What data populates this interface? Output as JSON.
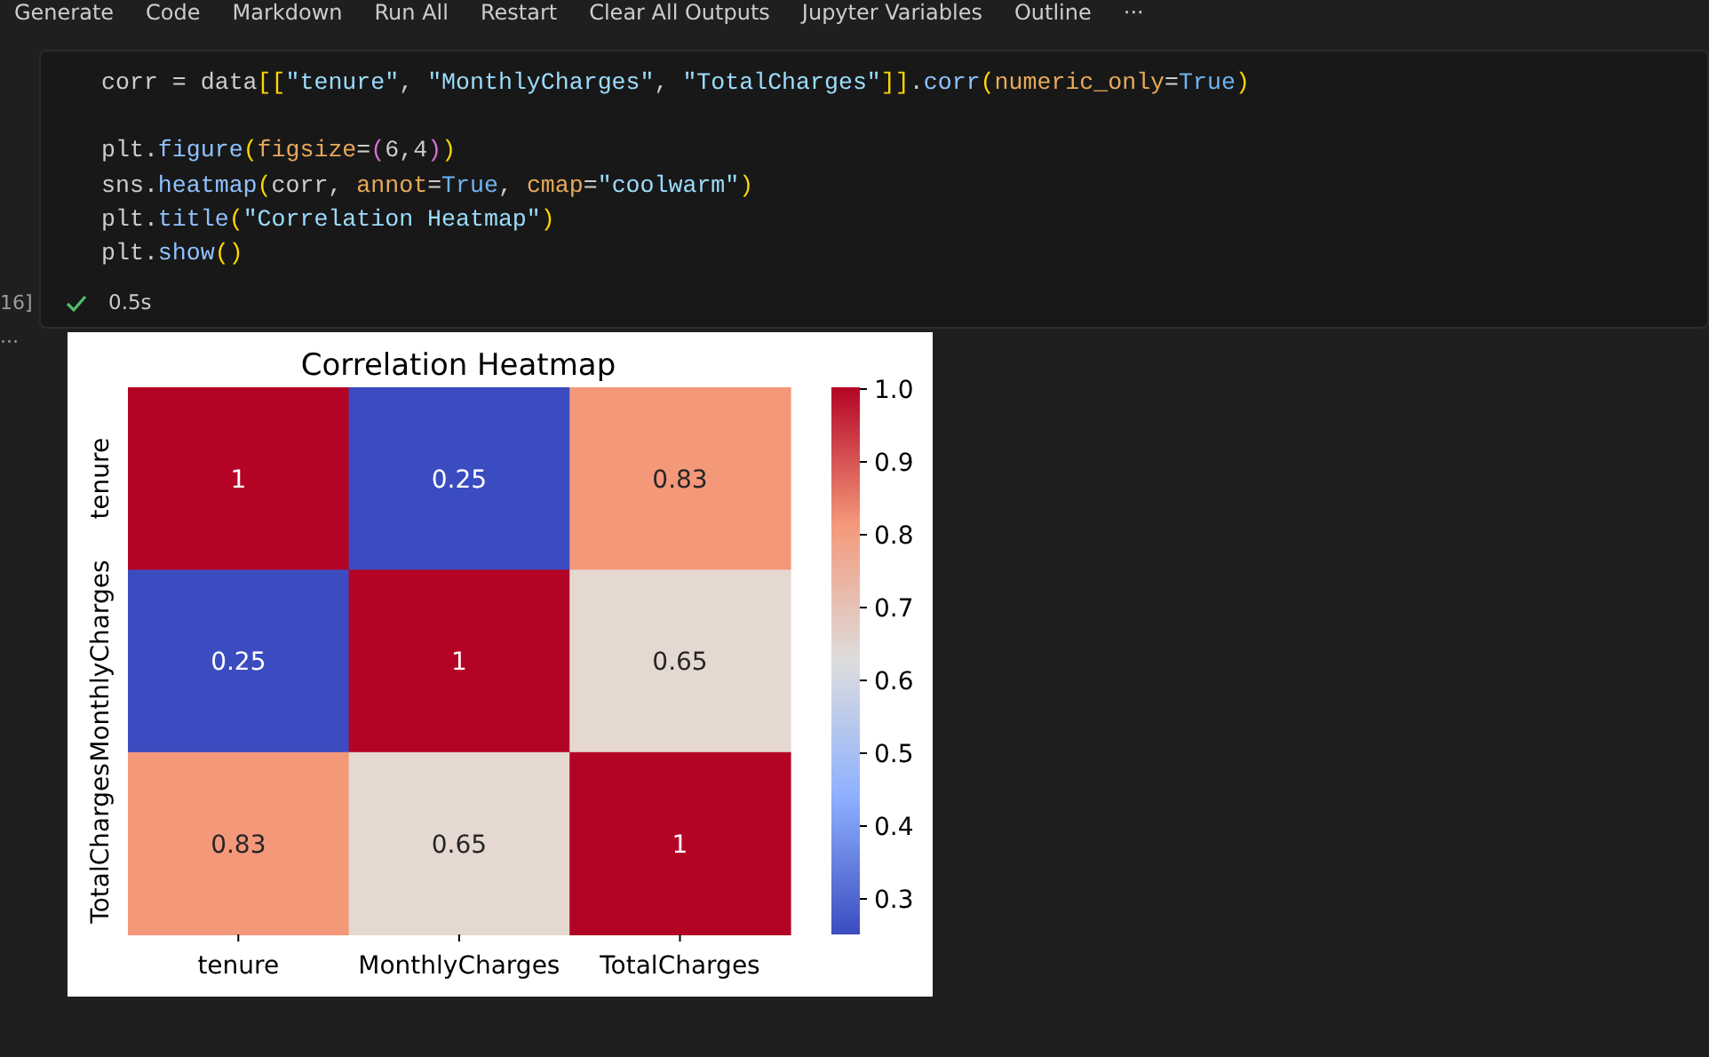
{
  "toolbar": [
    "Generate",
    "Code",
    "Markdown",
    "Run All",
    "Restart",
    "Clear All Outputs",
    "Jupyter Variables",
    "Outline",
    "···"
  ],
  "cell": {
    "execution_count": "16]",
    "code_lines": [
      [
        {
          "kind": "plain",
          "text": "corr = data"
        },
        {
          "kind": "bracket1",
          "text": "[["
        },
        {
          "kind": "string",
          "text": "\"tenure\""
        },
        {
          "kind": "plain",
          "text": ", "
        },
        {
          "kind": "string",
          "text": "\"MonthlyCharges\""
        },
        {
          "kind": "plain",
          "text": ", "
        },
        {
          "kind": "string",
          "text": "\"TotalCharges\""
        },
        {
          "kind": "bracket1",
          "text": "]]"
        },
        {
          "kind": "plain",
          "text": "."
        },
        {
          "kind": "func",
          "text": "corr"
        },
        {
          "kind": "bracket1",
          "text": "("
        },
        {
          "kind": "param",
          "text": "numeric_only"
        },
        {
          "kind": "plain",
          "text": "="
        },
        {
          "kind": "keyword",
          "text": "True"
        },
        {
          "kind": "bracket1",
          "text": ")"
        }
      ],
      [
        {
          "kind": "gap"
        },
        {
          "kind": "plain",
          "text": "plt."
        },
        {
          "kind": "func",
          "text": "figure"
        },
        {
          "kind": "bracket1",
          "text": "("
        },
        {
          "kind": "param",
          "text": "figsize"
        },
        {
          "kind": "plain",
          "text": "="
        },
        {
          "kind": "bracket2",
          "text": "("
        },
        {
          "kind": "plain",
          "text": "6,4"
        },
        {
          "kind": "bracket2",
          "text": ")"
        },
        {
          "kind": "bracket1",
          "text": ")"
        }
      ],
      [
        {
          "kind": "plain",
          "text": "sns."
        },
        {
          "kind": "func",
          "text": "heatmap"
        },
        {
          "kind": "bracket1",
          "text": "("
        },
        {
          "kind": "plain",
          "text": "corr, "
        },
        {
          "kind": "param",
          "text": "annot"
        },
        {
          "kind": "plain",
          "text": "="
        },
        {
          "kind": "keyword",
          "text": "True"
        },
        {
          "kind": "plain",
          "text": ", "
        },
        {
          "kind": "param",
          "text": "cmap"
        },
        {
          "kind": "plain",
          "text": "="
        },
        {
          "kind": "string",
          "text": "\"coolwarm\""
        },
        {
          "kind": "bracket1",
          "text": ")"
        }
      ],
      [
        {
          "kind": "plain",
          "text": "plt."
        },
        {
          "kind": "func",
          "text": "title"
        },
        {
          "kind": "bracket1",
          "text": "("
        },
        {
          "kind": "string",
          "text": "\"Correlation Heatmap\""
        },
        {
          "kind": "bracket1",
          "text": ")"
        }
      ],
      [
        {
          "kind": "plain",
          "text": "plt."
        },
        {
          "kind": "func",
          "text": "show"
        },
        {
          "kind": "bracket1",
          "text": "()"
        }
      ]
    ],
    "status": {
      "success": true,
      "duration": "0.5s"
    }
  },
  "output_more": "···",
  "heatmap": {
    "title": "Correlation Heatmap",
    "columns": [
      "tenure",
      "MonthlyCharges",
      "TotalCharges"
    ],
    "rows": [
      "tenure",
      "MonthlyCharges",
      "TotalCharges"
    ],
    "cells": [
      [
        {
          "text": "1",
          "color": "#b40426"
        },
        {
          "text": "0.25",
          "color": "#3b4cc0"
        },
        {
          "text": "0.83",
          "color": "#f4987a"
        }
      ],
      [
        {
          "text": "0.25",
          "color": "#3b4cc0"
        },
        {
          "text": "1",
          "color": "#b40426"
        },
        {
          "text": "0.65",
          "color": "#e5d8d1"
        }
      ],
      [
        {
          "text": "0.83",
          "color": "#f4987a"
        },
        {
          "text": "0.65",
          "color": "#e5d8d1"
        },
        {
          "text": "1",
          "color": "#b40426"
        }
      ]
    ],
    "colorbar_ticks": [
      "1.0",
      "0.9",
      "0.8",
      "0.7",
      "0.6",
      "0.5",
      "0.4",
      "0.3"
    ]
  }
}
